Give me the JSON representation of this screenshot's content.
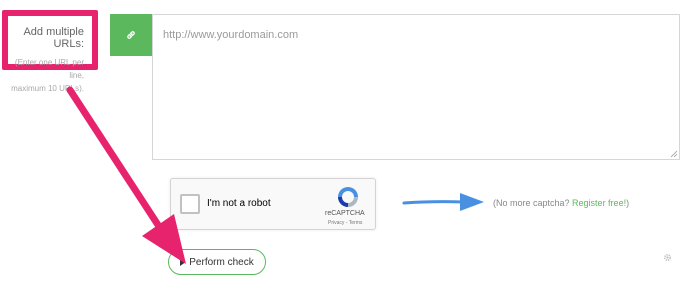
{
  "urls_section": {
    "label": "Add multiple URLs:",
    "hint_line1": "(Enter one URL per line,",
    "hint_line2": "maximum 10 URLs)."
  },
  "url_input": {
    "placeholder": "http://www.yourdomain.com",
    "value": ""
  },
  "captcha": {
    "label": "I'm not a robot",
    "brand": "reCAPTCHA",
    "links": "Privacy - Terms",
    "checked": false
  },
  "register_prompt": {
    "text": "(No more captcha? ",
    "link": "Register free!",
    "suffix": ")"
  },
  "actions": {
    "perform_label": "Perform check"
  },
  "icons": {
    "url_addon": "link-icon",
    "perform": "caret-right-icon",
    "settings": "gear-icon"
  },
  "colors": {
    "accent_green": "#5cb85c",
    "highlight_pink": "#e8236d",
    "arrow_blue": "#4a90e2"
  }
}
